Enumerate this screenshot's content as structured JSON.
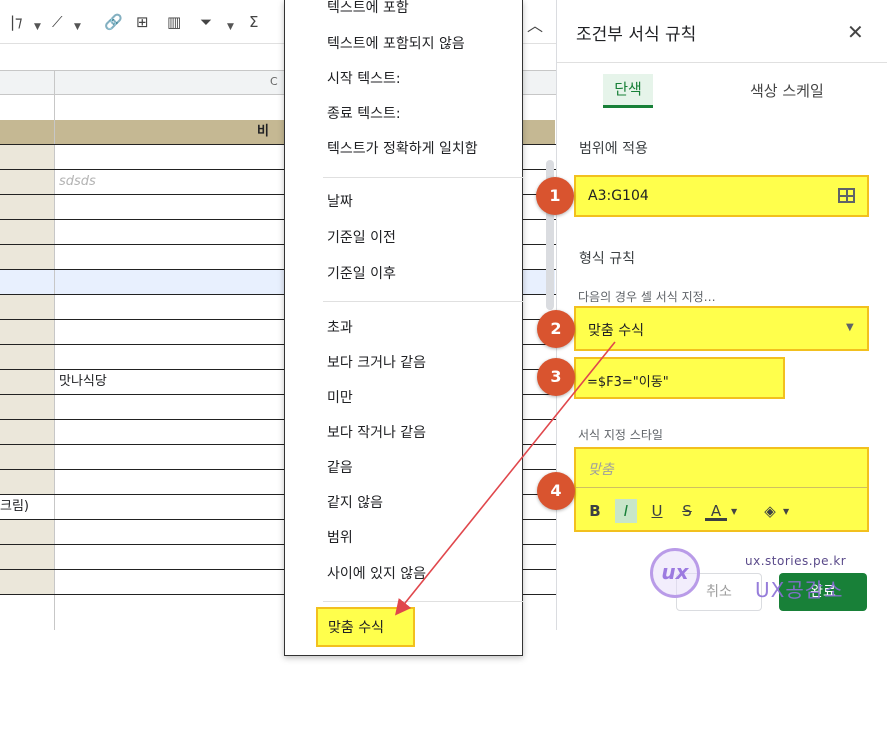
{
  "sheet": {
    "column_header_letter": "C",
    "rows": [
      {
        "a": "",
        "b": "",
        "type": "blank"
      },
      {
        "a": "",
        "b": "비",
        "type": "head"
      },
      {
        "a": "",
        "b": ""
      },
      {
        "a": "",
        "b": "sdsds",
        "type": "placeholder"
      },
      {
        "a": "",
        "b": ""
      },
      {
        "a": "",
        "b": ""
      },
      {
        "a": "",
        "b": ""
      },
      {
        "a": "",
        "b": "",
        "type": "sel"
      },
      {
        "a": "",
        "b": ""
      },
      {
        "a": "",
        "b": ""
      },
      {
        "a": "",
        "b": ""
      },
      {
        "a": "",
        "b": "맛나식당"
      },
      {
        "a": "",
        "b": ""
      },
      {
        "a": "",
        "b": ""
      },
      {
        "a": "",
        "b": ""
      },
      {
        "a": "",
        "b": ""
      },
      {
        "a": "크림)",
        "b": "",
        "type": "lefttext"
      },
      {
        "a": "",
        "b": ""
      },
      {
        "a": "",
        "b": ""
      },
      {
        "a": "",
        "b": ""
      }
    ]
  },
  "menu": {
    "groups": [
      [
        "텍스트에 포함",
        "텍스트에 포함되지 않음",
        "시작 텍스트:",
        "종료 텍스트:",
        "텍스트가 정확하게 일치함"
      ],
      [
        "날짜",
        "기준일 이전",
        "기준일 이후"
      ],
      [
        "초과",
        "보다 크거나 같음",
        "미만",
        "보다 작거나 같음",
        "같음",
        "같지 않음",
        "범위",
        "사이에 있지 않음"
      ]
    ],
    "highlighted": "맞춤 수식"
  },
  "panel": {
    "title": "조건부 서식 규칙",
    "tab_single": "단색",
    "tab_scale": "색상 스케일",
    "range_label": "범위에 적용",
    "range_value": "A3:G104",
    "rules_label": "형식 규칙",
    "condition_label": "다음의 경우 셀 서식 지정…",
    "condition_value": "맞춤 수식",
    "formula_value": "=$F3=\"이동\"",
    "style_label": "서식 지정 스타일",
    "style_preview": "맞춤",
    "style_buttons": {
      "bold": "B",
      "italic": "I",
      "underline": "U",
      "strike": "S",
      "text_color": "A"
    },
    "cancel": "취소",
    "done": "완료"
  },
  "markers": [
    "1",
    "2",
    "3",
    "4"
  ],
  "watermark": {
    "site": "ux.stories.pe.kr",
    "brand": "UX공감소",
    "logo": "ux"
  },
  "colors": {
    "highlight": "#ffff4c",
    "highlight_border": "#f2c01e",
    "marker": "#d9542f",
    "accent": "#188038",
    "arrow": "#e0474c"
  }
}
